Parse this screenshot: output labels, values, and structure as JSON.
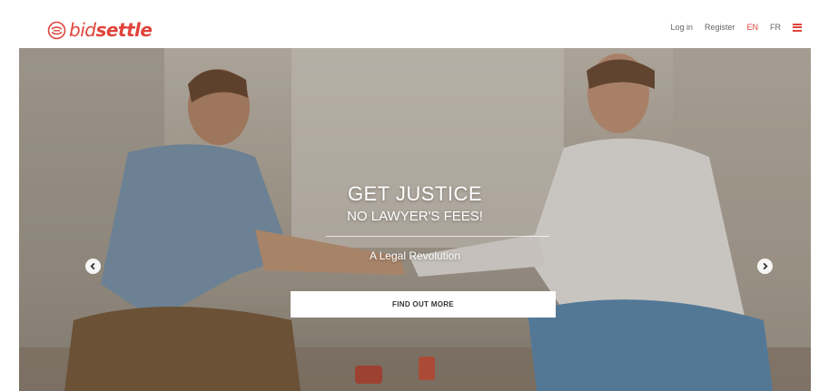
{
  "brand": {
    "part1": "bid",
    "part2": "settle",
    "color": "#e0443c"
  },
  "nav": {
    "login": "Log in",
    "register": "Register",
    "lang_en": "EN",
    "lang_fr": "FR",
    "active_lang": "EN",
    "menu_icon": "hamburger-icon"
  },
  "hero": {
    "title": "GET JUSTICE",
    "subtitle": "NO LAWYER'S FEES!",
    "tagline": "A Legal Revolution",
    "cta_label": "FIND OUT MORE",
    "prev_icon": "chevron-left-icon",
    "next_icon": "chevron-right-icon"
  }
}
